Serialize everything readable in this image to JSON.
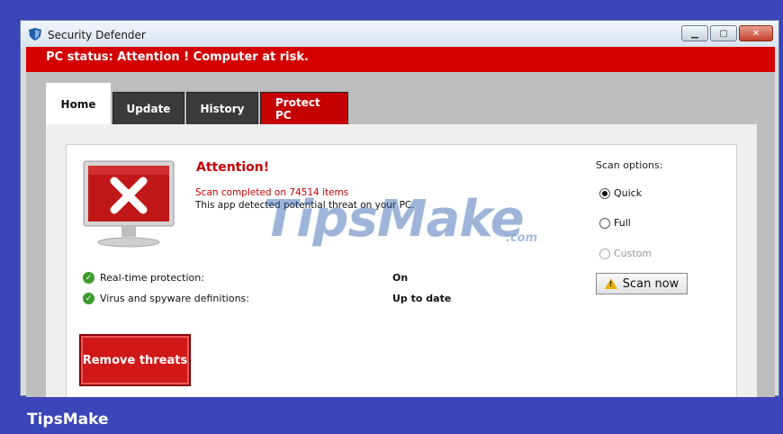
{
  "window": {
    "title": "Security Defender",
    "buttons": {
      "minimize_icon": "minimize-icon",
      "maximize_icon": "maximize-icon",
      "close_icon": "close-icon"
    }
  },
  "status": {
    "text": "PC status: Attention ! Computer at risk."
  },
  "tabs": [
    {
      "label": "Home"
    },
    {
      "label": "Update"
    },
    {
      "label": "History"
    },
    {
      "label": "Protect PC"
    }
  ],
  "alert": {
    "title": "Attention!",
    "scan_line": "Scan completed on 74514 items",
    "detect_line": "This app detected potential threat on your PC."
  },
  "protection": [
    {
      "label": "Real-time protection:",
      "value": "On"
    },
    {
      "label": "Virus and spyware definitions:",
      "value": "Up to date"
    }
  ],
  "remove_button": "Remove threats",
  "scan_options": {
    "title": "Scan options:",
    "options": [
      {
        "label": "Quick",
        "selected": true
      },
      {
        "label": "Full",
        "selected": false
      },
      {
        "label": "Custom",
        "selected": false,
        "disabled": true
      }
    ],
    "scan_button": "Scan now"
  },
  "watermark": {
    "main": "TipsMake",
    "suffix": ".com"
  },
  "footer": {
    "brand": "TipsMake"
  },
  "colors": {
    "accent_red": "#d40000",
    "background_blue": "#3a45b8",
    "ok_green": "#3b9b2c"
  }
}
